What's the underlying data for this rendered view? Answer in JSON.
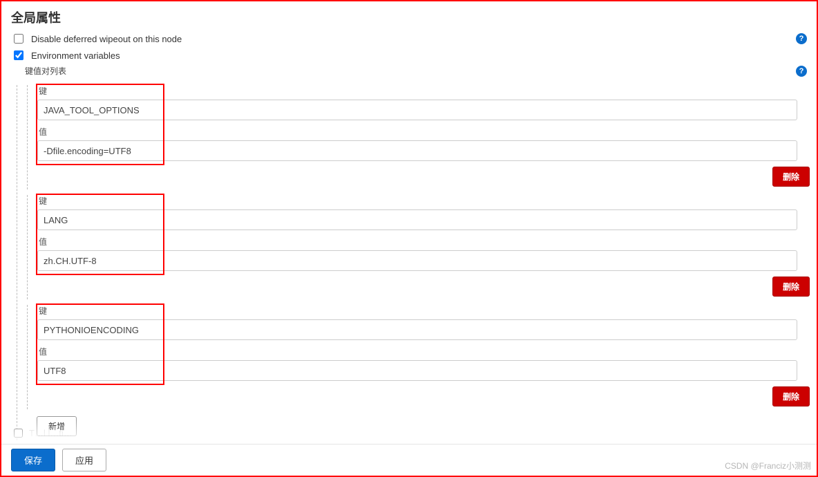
{
  "page": {
    "title": "全局属性"
  },
  "checkboxes": {
    "disable_wipeout": {
      "label": "Disable deferred wipeout on this node",
      "checked": false
    },
    "env_vars": {
      "label": "Environment variables",
      "checked": true
    }
  },
  "kv_list": {
    "section_label": "键值对列表",
    "key_label": "键",
    "value_label": "值",
    "delete_label": "删除",
    "add_label": "新增",
    "items": [
      {
        "key": "JAVA_TOOL_OPTIONS",
        "value": "-Dfile.encoding=UTF8"
      },
      {
        "key": "LANG",
        "value": "zh.CH.UTF-8"
      },
      {
        "key": "PYTHONIOENCODING",
        "value": "UTF8"
      }
    ]
  },
  "cutoff_row": {
    "label": "T…l l…ti…"
  },
  "buttons": {
    "save": "保存",
    "apply": "应用"
  },
  "watermark": "CSDN @Franciz小测测",
  "help_glyph": "?"
}
